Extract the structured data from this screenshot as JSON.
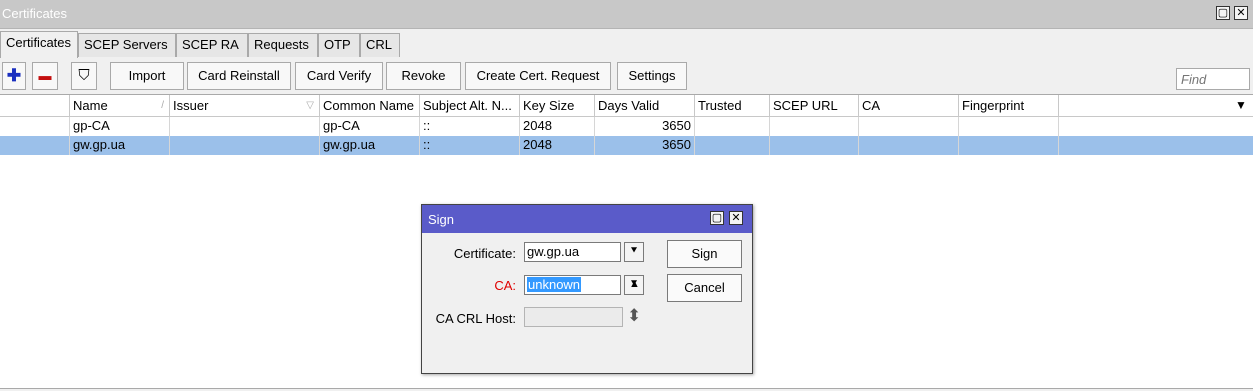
{
  "window": {
    "title": "Certificates",
    "restore_glyph": "▢",
    "close_glyph": "✕"
  },
  "tabs": [
    "Certificates",
    "SCEP Servers",
    "SCEP RA",
    "Requests",
    "OTP",
    "CRL"
  ],
  "toolbar": {
    "add_glyph": "✚",
    "remove_glyph": "▬",
    "filter_glyph": "⛉",
    "buttons": [
      "Import",
      "Card Reinstall",
      "Card Verify",
      "Revoke",
      "Create Cert. Request",
      "Settings"
    ],
    "find_placeholder": "Find"
  },
  "table": {
    "columns": [
      "",
      "Name",
      "Issuer",
      "Common Name",
      "Subject Alt. N...",
      "Key Size",
      "Days Valid",
      "Trusted",
      "SCEP URL",
      "CA",
      "Fingerprint",
      ""
    ],
    "sort_marks": {
      "name": "/",
      "issuer": "▽"
    },
    "dropdown_glyph": "▼",
    "rows": [
      {
        "flags": "",
        "name": "gp-CA",
        "issuer": "",
        "common_name": "gp-CA",
        "subject_alt": "::",
        "key_size": "2048",
        "days_valid": "3650",
        "trusted": "",
        "scep_url": "",
        "ca": "",
        "fingerprint": "",
        "selected": false
      },
      {
        "flags": "",
        "name": "gw.gp.ua",
        "issuer": "",
        "common_name": "gw.gp.ua",
        "subject_alt": "::",
        "key_size": "2048",
        "days_valid": "3650",
        "trusted": "",
        "scep_url": "",
        "ca": "",
        "fingerprint": "",
        "selected": true
      }
    ]
  },
  "dialog": {
    "title": "Sign",
    "restore_glyph": "▢",
    "close_glyph": "✕",
    "certificate_label": "Certificate:",
    "certificate_value": "gw.gp.ua",
    "ca_label": "CA:",
    "ca_value": "unknown",
    "ca_crl_host_label": "CA CRL Host:",
    "ca_crl_host_value": "",
    "dropdown_glyph": "⯆",
    "up_glyph": "▲",
    "updown_glyph": "⬍",
    "sign_button": "Sign",
    "cancel_button": "Cancel",
    "error_color": "#e00000",
    "selection_color": "#3399ff"
  },
  "colors": {
    "selected_row": "#9bc0ea",
    "dialog_title_bar": "#5a5bc9",
    "add_icon": "#1a2fbf",
    "remove_icon": "#c41010"
  }
}
